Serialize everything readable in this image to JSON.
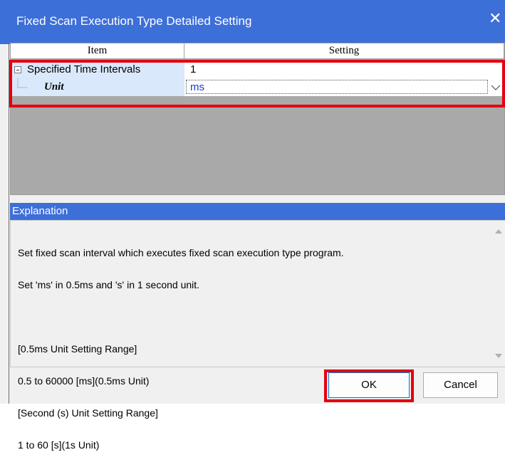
{
  "dialog": {
    "title": "Fixed Scan Execution Type Detailed Setting",
    "close_icon": "close-icon"
  },
  "grid": {
    "headers": [
      "Item",
      "Setting"
    ],
    "rows": [
      {
        "item": "Specified Time Intervals",
        "setting": "1",
        "expanded": true
      },
      {
        "item": "Unit",
        "setting": "ms"
      }
    ]
  },
  "explanation": {
    "header": "Explanation",
    "lines": [
      "Set fixed scan interval which executes fixed scan execution type program.",
      "Set 'ms' in 0.5ms and 's' in 1 second unit.",
      "",
      "[0.5ms Unit Setting Range]",
      "0.5 to 60000 [ms](0.5ms Unit)",
      "[Second (s) Unit Setting Range]",
      "1 to 60 [s](1s Unit)"
    ]
  },
  "buttons": {
    "ok": "OK",
    "cancel": "Cancel"
  },
  "colors": {
    "title_bar": "#3d6fd8",
    "highlight": "#e3000f",
    "item_cell": "#d9e8fb",
    "unit_value": "#1a3acf"
  }
}
